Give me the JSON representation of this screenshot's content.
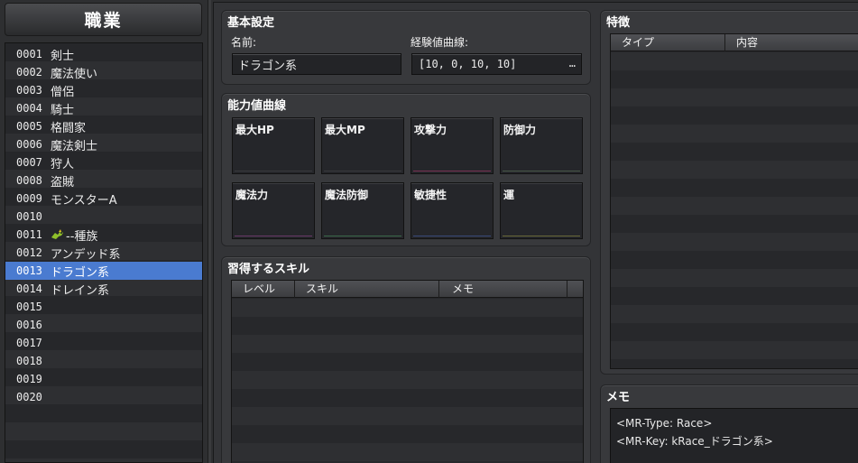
{
  "left_panel": {
    "title": "職業",
    "items": [
      {
        "num": "0001",
        "name": "剣士"
      },
      {
        "num": "0002",
        "name": "魔法使い"
      },
      {
        "num": "0003",
        "name": "僧侶"
      },
      {
        "num": "0004",
        "name": "騎士"
      },
      {
        "num": "0005",
        "name": "格闘家"
      },
      {
        "num": "0006",
        "name": "魔法剣士"
      },
      {
        "num": "0007",
        "name": "狩人"
      },
      {
        "num": "0008",
        "name": "盗賊"
      },
      {
        "num": "0009",
        "name": "モンスターA"
      },
      {
        "num": "0010",
        "name": ""
      },
      {
        "num": "0011",
        "name": "--種族",
        "icon": "dragon-icon"
      },
      {
        "num": "0012",
        "name": "アンデッド系"
      },
      {
        "num": "0013",
        "name": "ドラゴン系",
        "selected": true
      },
      {
        "num": "0014",
        "name": "ドレイン系"
      },
      {
        "num": "0015",
        "name": ""
      },
      {
        "num": "0016",
        "name": ""
      },
      {
        "num": "0017",
        "name": ""
      },
      {
        "num": "0018",
        "name": ""
      },
      {
        "num": "0019",
        "name": ""
      },
      {
        "num": "0020",
        "name": ""
      }
    ],
    "selected_color": "#4a7bd0"
  },
  "basic": {
    "title": "基本設定",
    "name_label": "名前:",
    "name_value": "ドラゴン系",
    "exp_label": "経験値曲線:",
    "exp_value": "[10, 0, 10, 10]",
    "exp_button": "…"
  },
  "params": {
    "title": "能力値曲線",
    "items": [
      {
        "label": "最大HP",
        "line_color": "#3a3b3e"
      },
      {
        "label": "最大MP",
        "line_color": "#3a3b3e"
      },
      {
        "label": "攻撃力",
        "line_color": "#7a3355"
      },
      {
        "label": "防御力",
        "line_color": "#4a5a4a"
      },
      {
        "label": "魔法力",
        "line_color": "#6a3a6a"
      },
      {
        "label": "魔法防御",
        "line_color": "#3c6a4a"
      },
      {
        "label": "敏捷性",
        "line_color": "#3a4a7a"
      },
      {
        "label": "運",
        "line_color": "#6a6a3a"
      }
    ]
  },
  "skills": {
    "title": "習得するスキル",
    "columns": [
      "レベル",
      "スキル",
      "メモ"
    ]
  },
  "traits": {
    "title": "特徴",
    "columns": [
      "タイプ",
      "内容"
    ]
  },
  "memo": {
    "title": "メモ",
    "lines": [
      "<MR-Type: Race>",
      "<MR-Key: kRace_ドラゴン系>"
    ]
  }
}
